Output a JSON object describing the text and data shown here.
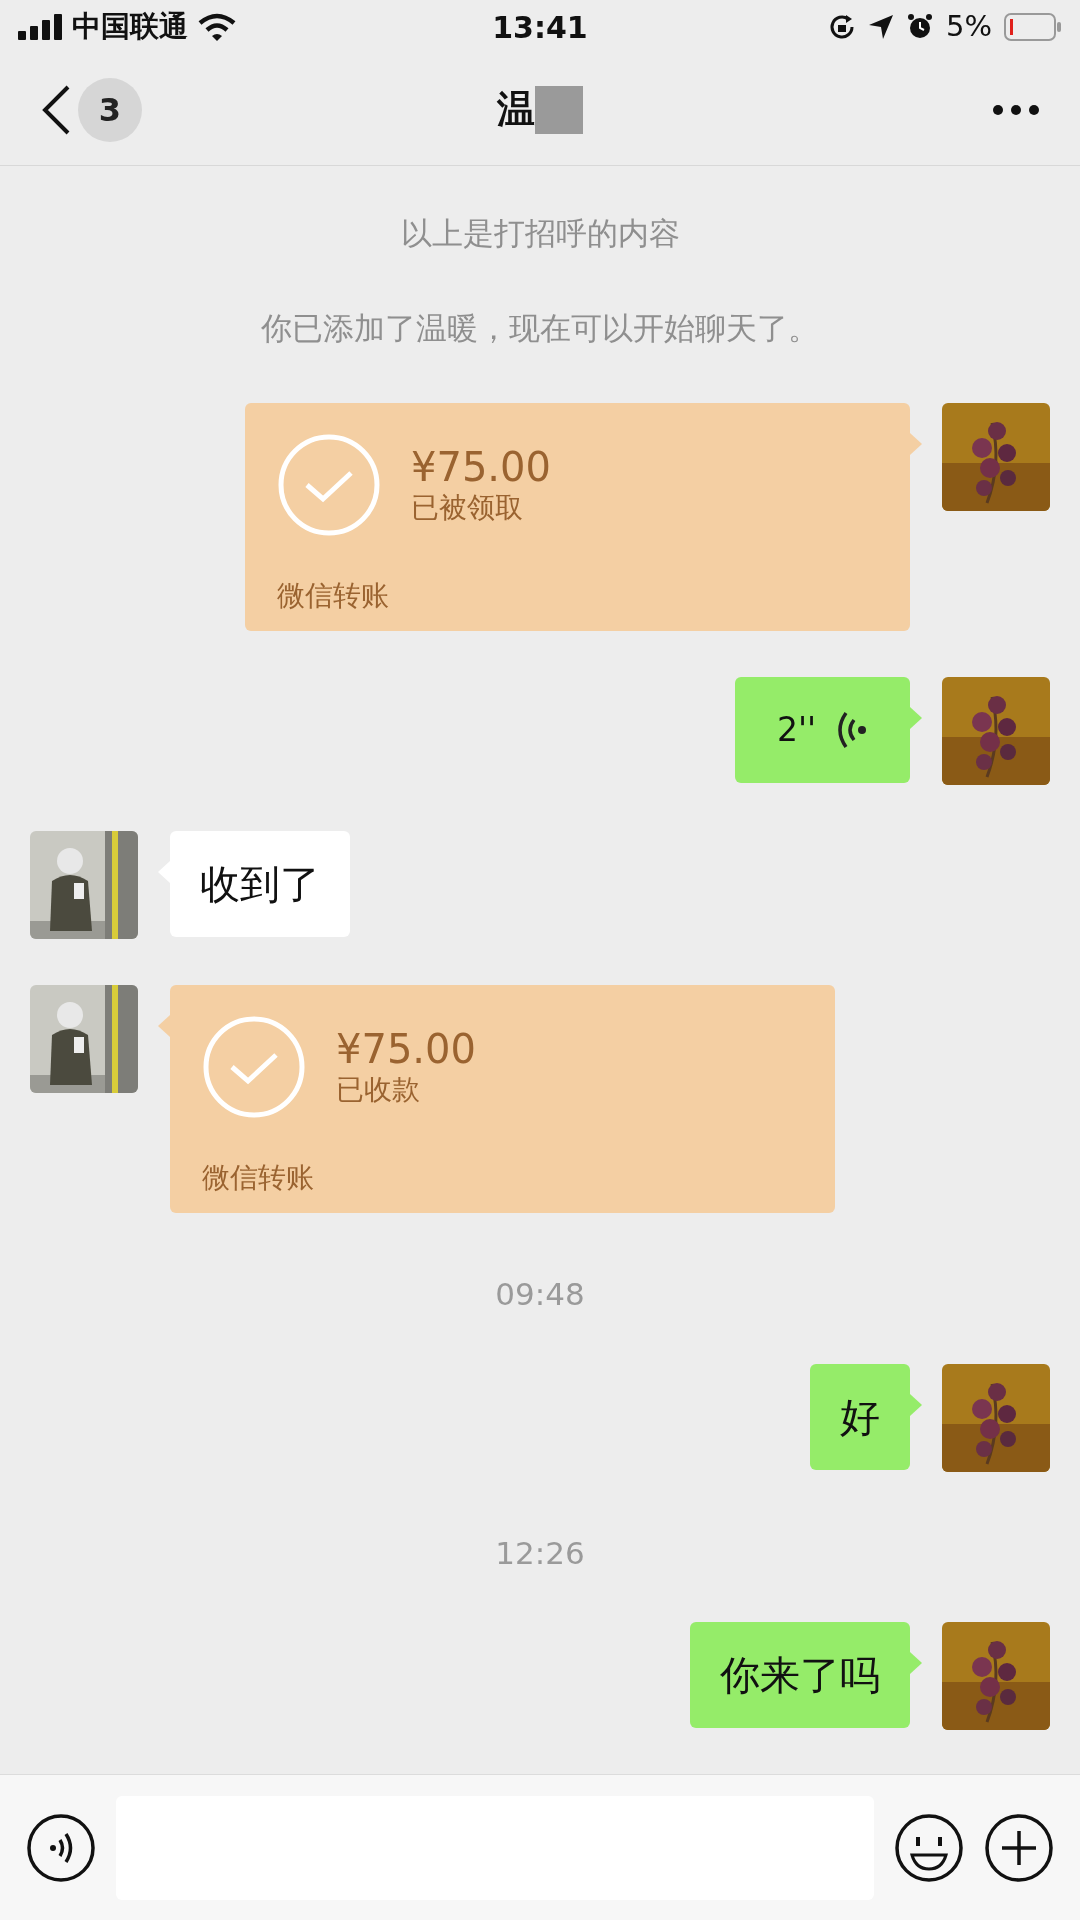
{
  "status_bar": {
    "carrier": "中国联通",
    "time": "13:41",
    "battery": "5%"
  },
  "nav": {
    "back_badge": "3",
    "title": "温"
  },
  "messages": [
    {
      "kind": "notice",
      "text": "以上是打招呼的内容"
    },
    {
      "kind": "notice",
      "text": "你已添加了温暖，现在可以开始聊天了。"
    },
    {
      "kind": "transfer",
      "outgoing": true,
      "amount": "¥75.00",
      "status": "已被领取",
      "label": "微信转账"
    },
    {
      "kind": "voice",
      "outgoing": true,
      "duration": "2''"
    },
    {
      "kind": "text",
      "outgoing": false,
      "text": "收到了"
    },
    {
      "kind": "transfer",
      "outgoing": false,
      "amount": "¥75.00",
      "status": "已收款",
      "label": "微信转账"
    },
    {
      "kind": "time",
      "text": "09:48"
    },
    {
      "kind": "text",
      "outgoing": true,
      "text": "好"
    },
    {
      "kind": "time",
      "text": "12:26"
    },
    {
      "kind": "text",
      "outgoing": true,
      "text": "你来了吗"
    }
  ]
}
